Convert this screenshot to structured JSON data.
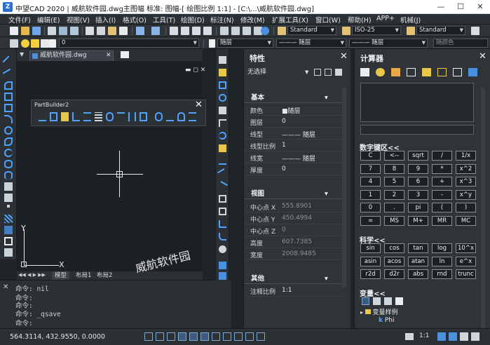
{
  "window": {
    "title": "中望CAD 2020 | 威航软件园.dwg主图幅  标准: 图幅-[ 绘图比例 1:1]  - [C:\\...\\威航软件园.dwg]",
    "app_icon_text": "Z",
    "minimize": "—",
    "maximize": "☐",
    "close": "✕"
  },
  "menu": [
    "文件(F)",
    "编辑(E)",
    "视图(V)",
    "插入(I)",
    "格式(O)",
    "工具(T)",
    "绘图(D)",
    "标注(N)",
    "修改(M)",
    "扩展工具(X)",
    "窗口(W)",
    "帮助(H)",
    "APP+",
    "机械(J)"
  ],
  "toolbar2": {
    "text_style": "Standard",
    "dim_style": "ISO-25",
    "table_style": "Standard"
  },
  "toolbar3": {
    "layer_value": "0",
    "color_value": "随层",
    "linetype_value": "随层",
    "lineweight_value": "随层",
    "plotstyle_value": "随颜色"
  },
  "drawing": {
    "doc_tab": "威航软件园.dwg",
    "axis_y": "Y",
    "axis_x": "X",
    "model_tabs": [
      "模型",
      "布局1",
      "布局2"
    ],
    "watermark": "威航软件园"
  },
  "partbuilder": {
    "title": "PartBuilder2",
    "close": "✕"
  },
  "command": {
    "lines": [
      "命令: nil",
      "命令:",
      "命令:",
      "命令: _qsave",
      "命令:"
    ]
  },
  "status": {
    "coords": "564.3114, 432.9550, 0.0000",
    "scale": "1:1"
  },
  "properties": {
    "title": "特性",
    "selection": "无选择",
    "sections": {
      "basic": "基本",
      "view": "视图",
      "other": "其他"
    },
    "basic_rows": [
      {
        "label": "颜色",
        "value": "■随层"
      },
      {
        "label": "图层",
        "value": "0"
      },
      {
        "label": "线型",
        "value": "——— 随层"
      },
      {
        "label": "线型比例",
        "value": "1"
      },
      {
        "label": "线宽",
        "value": "——— 随层"
      },
      {
        "label": "厚度",
        "value": "0"
      }
    ],
    "view_rows": [
      {
        "label": "中心点 X",
        "value": "555.8901"
      },
      {
        "label": "中心点 Y",
        "value": "450.4994"
      },
      {
        "label": "中心点 Z",
        "value": "0"
      },
      {
        "label": "高度",
        "value": "607.7385"
      },
      {
        "label": "宽度",
        "value": "2008.9485"
      }
    ],
    "other_rows": [
      {
        "label": "注释比例",
        "value": "1:1"
      }
    ]
  },
  "calculator": {
    "title": "计算器",
    "numpad_title": "数字键区<<",
    "sci_title": "科学<<",
    "var_title": "变量<<",
    "numpad": [
      [
        "C",
        "<--",
        "sqrt",
        "/",
        "1/x"
      ],
      [
        "7",
        "8",
        "9",
        "*",
        "x^2"
      ],
      [
        "4",
        "5",
        "6",
        "+",
        "x^3"
      ],
      [
        "1",
        "2",
        "3",
        "-",
        "x^y"
      ],
      [
        "0",
        ".",
        "pi",
        "(",
        ")"
      ],
      [
        "=",
        "MS",
        "M+",
        "MR",
        "MC"
      ]
    ],
    "scientific": [
      [
        "sin",
        "cos",
        "tan",
        "log",
        "10^x"
      ],
      [
        "asin",
        "acos",
        "atan",
        "ln",
        "e^x"
      ],
      [
        "r2d",
        "d2r",
        "abs",
        "rnd",
        "trunc"
      ]
    ],
    "variables": {
      "folder": "变量样例",
      "item": "Phi",
      "item_icon": "k"
    }
  }
}
